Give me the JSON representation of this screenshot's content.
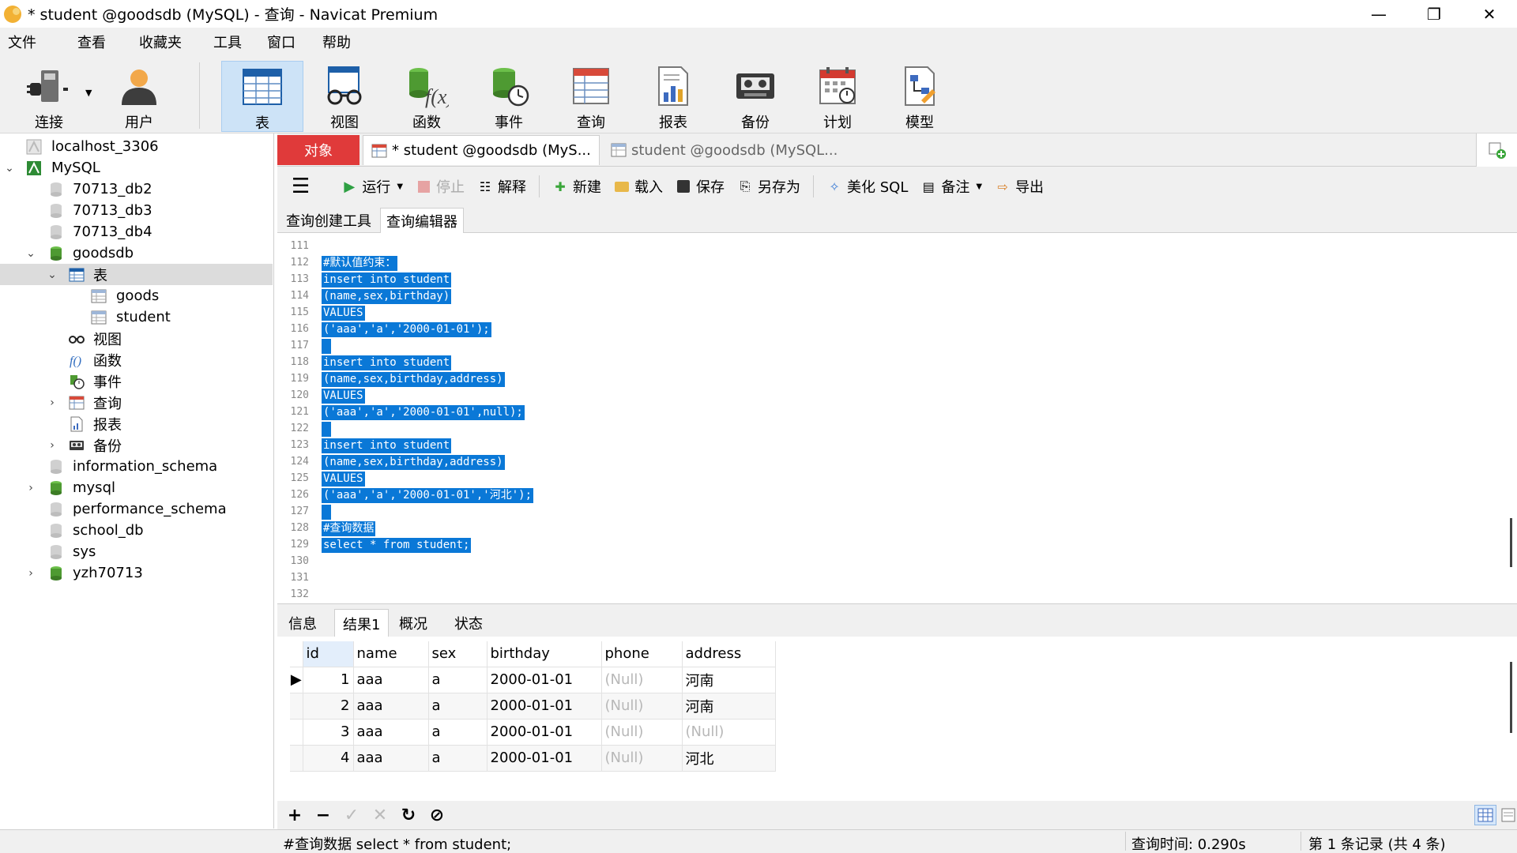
{
  "window": {
    "title": "* student @goodsdb (MySQL) - 查询 - Navicat Premium",
    "minimize": "—",
    "maximize": "❐",
    "close": "✕"
  },
  "menu": [
    "文件",
    "查看",
    "收藏夹",
    "工具",
    "窗口",
    "帮助"
  ],
  "toolbar": [
    {
      "label": "连接",
      "icon": "plug-icon"
    },
    {
      "label": "用户",
      "icon": "user-icon"
    },
    {
      "label": "表",
      "icon": "table-icon"
    },
    {
      "label": "视图",
      "icon": "view-glasses-icon"
    },
    {
      "label": "函数",
      "icon": "function-icon"
    },
    {
      "label": "事件",
      "icon": "event-clock-icon"
    },
    {
      "label": "查询",
      "icon": "query-icon"
    },
    {
      "label": "报表",
      "icon": "report-icon"
    },
    {
      "label": "备份",
      "icon": "backup-tape-icon"
    },
    {
      "label": "计划",
      "icon": "calendar-icon"
    },
    {
      "label": "模型",
      "icon": "model-icon"
    }
  ],
  "tree": [
    {
      "label": "localhost_3306"
    },
    {
      "label": "MySQL"
    },
    {
      "label": "70713_db2"
    },
    {
      "label": "70713_db3"
    },
    {
      "label": "70713_db4"
    },
    {
      "label": "goodsdb"
    },
    {
      "label": "表"
    },
    {
      "label": "goods"
    },
    {
      "label": "student"
    },
    {
      "label": "视图"
    },
    {
      "label": "函数"
    },
    {
      "label": "事件"
    },
    {
      "label": "查询"
    },
    {
      "label": "报表"
    },
    {
      "label": "备份"
    },
    {
      "label": "information_schema"
    },
    {
      "label": "mysql"
    },
    {
      "label": "performance_schema"
    },
    {
      "label": "school_db"
    },
    {
      "label": "sys"
    },
    {
      "label": "yzh70713"
    }
  ],
  "doc_tabs": {
    "objects": "对象",
    "tab1": "* student @goodsdb (MyS...",
    "tab2": "student @goodsdb (MySQL..."
  },
  "query_toolbar": {
    "run": "运行",
    "stop": "停止",
    "explain": "解释",
    "new": "新建",
    "load": "载入",
    "save": "保存",
    "save_as": "另存为",
    "beautify": "美化 SQL",
    "comment": "备注",
    "export": "导出"
  },
  "sub_tabs": {
    "builder": "查询创建工具",
    "editor": "查询编辑器"
  },
  "editor": {
    "lines": [
      {
        "n": "111",
        "code": ""
      },
      {
        "n": "112",
        "code": "#默认值约束："
      },
      {
        "n": "113",
        "code": "insert into student"
      },
      {
        "n": "114",
        "code": "(name,sex,birthday)"
      },
      {
        "n": "115",
        "code": "VALUES"
      },
      {
        "n": "116",
        "code": "('aaa','a','2000-01-01');"
      },
      {
        "n": "117",
        "code": " "
      },
      {
        "n": "118",
        "code": "insert into student"
      },
      {
        "n": "119",
        "code": "(name,sex,birthday,address)"
      },
      {
        "n": "120",
        "code": "VALUES"
      },
      {
        "n": "121",
        "code": "('aaa','a','2000-01-01',null);"
      },
      {
        "n": "122",
        "code": " "
      },
      {
        "n": "123",
        "code": "insert into student"
      },
      {
        "n": "124",
        "code": "(name,sex,birthday,address)"
      },
      {
        "n": "125",
        "code": "VALUES"
      },
      {
        "n": "126",
        "code": "('aaa','a','2000-01-01','河北');"
      },
      {
        "n": "127",
        "code": " "
      },
      {
        "n": "128",
        "code": "#查询数据"
      },
      {
        "n": "129",
        "code": "select * from student;"
      },
      {
        "n": "130",
        "code": ""
      },
      {
        "n": "131",
        "code": ""
      },
      {
        "n": "132",
        "code": ""
      }
    ]
  },
  "result_tabs": {
    "info": "信息",
    "result1": "结果1",
    "profile": "概况",
    "status": "状态"
  },
  "grid": {
    "columns": [
      "id",
      "name",
      "sex",
      "birthday",
      "phone",
      "address"
    ],
    "rows": [
      [
        "1",
        "aaa",
        "a",
        "2000-01-01",
        "(Null)",
        "河南"
      ],
      [
        "2",
        "aaa",
        "a",
        "2000-01-01",
        "(Null)",
        "河南"
      ],
      [
        "3",
        "aaa",
        "a",
        "2000-01-01",
        "(Null)",
        "(Null)"
      ],
      [
        "4",
        "aaa",
        "a",
        "2000-01-01",
        "(Null)",
        "河北"
      ]
    ]
  },
  "grid_toolbar": {
    "add": "+",
    "remove": "−",
    "apply": "✓",
    "discard": "✕",
    "refresh": "↻",
    "stop": "⊘"
  },
  "status": {
    "sql": "#查询数据 select * from student;",
    "time": "查询时间: 0.290s",
    "records": "第 1 条记录 (共 4 条)"
  }
}
